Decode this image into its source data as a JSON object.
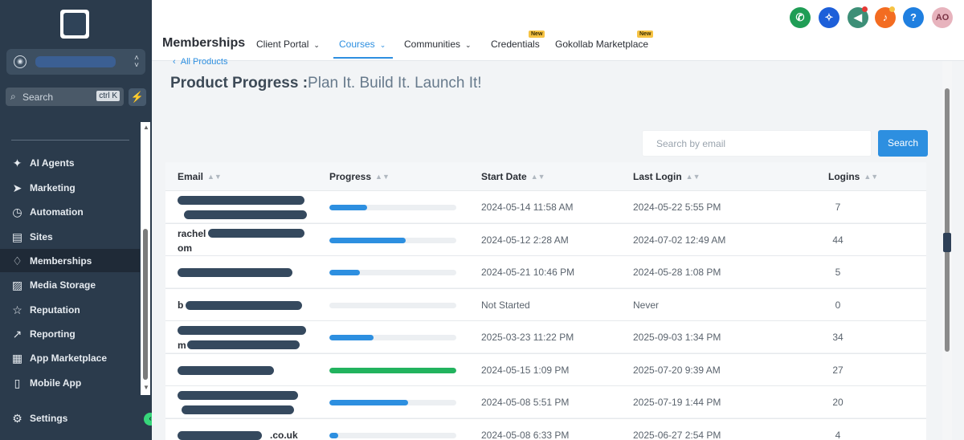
{
  "sidebar": {
    "search_placeholder": "Search",
    "search_shortcut": "ctrl K",
    "nav": [
      {
        "label": "AI Agents",
        "icon": "sparkle-icon",
        "glyph": "✦"
      },
      {
        "label": "Marketing",
        "icon": "send-icon",
        "glyph": "➤"
      },
      {
        "label": "Automation",
        "icon": "play-circle-icon",
        "glyph": "◷"
      },
      {
        "label": "Sites",
        "icon": "browser-icon",
        "glyph": "▤"
      },
      {
        "label": "Memberships",
        "icon": "award-icon",
        "glyph": "♢"
      },
      {
        "label": "Media Storage",
        "icon": "image-icon",
        "glyph": "▨"
      },
      {
        "label": "Reputation",
        "icon": "star-icon",
        "glyph": "☆"
      },
      {
        "label": "Reporting",
        "icon": "trend-icon",
        "glyph": "↗"
      },
      {
        "label": "App Marketplace",
        "icon": "grid-icon",
        "glyph": "▦"
      },
      {
        "label": "Mobile App",
        "icon": "phone-icon",
        "glyph": "▯"
      }
    ],
    "active": "Memberships",
    "settings_label": "Settings"
  },
  "header": {
    "section_title": "Memberships",
    "tabs": [
      {
        "label": "Client Portal",
        "dropdown": true,
        "badge": ""
      },
      {
        "label": "Courses",
        "dropdown": true,
        "badge": ""
      },
      {
        "label": "Communities",
        "dropdown": true,
        "badge": ""
      },
      {
        "label": "Credentials",
        "dropdown": false,
        "badge": "New"
      },
      {
        "label": "Gokollab Marketplace",
        "dropdown": false,
        "badge": "New"
      }
    ],
    "active_tab": "Courses",
    "avatar_initials": "AO",
    "help_glyph": "?"
  },
  "page": {
    "back_link": "All Products",
    "title_prefix": "Product Progress :",
    "title_product": "Plan It. Build It. Launch It!",
    "search_placeholder": "Search by email",
    "search_button": "Search"
  },
  "table": {
    "columns": [
      "Email",
      "Progress",
      "Start Date",
      "Last Login",
      "Logins"
    ],
    "rows": [
      {
        "email_lines": [
          "",
          ""
        ],
        "progress": 0.3,
        "color": "#2d8fe0",
        "start": "2024-05-14 11:58 AM",
        "last": "2024-05-22 5:55 PM",
        "logins": "7"
      },
      {
        "email_lines": [
          "rachel",
          "om"
        ],
        "progress": 0.6,
        "color": "#2d8fe0",
        "start": "2024-05-12 2:28 AM",
        "last": "2024-07-02 12:49 AM",
        "logins": "44"
      },
      {
        "email_lines": [
          "",
          ""
        ],
        "progress": 0.24,
        "color": "#2d8fe0",
        "start": "2024-05-21 10:46 PM",
        "last": "2024-05-28 1:08 PM",
        "logins": "5"
      },
      {
        "email_lines": [
          "b",
          ""
        ],
        "progress": 0,
        "color": "#2d8fe0",
        "start": "Not Started",
        "last": "Never",
        "logins": "0"
      },
      {
        "email_lines": [
          "",
          "m"
        ],
        "progress": 0.35,
        "color": "#2d8fe0",
        "start": "2025-03-23 11:22 PM",
        "last": "2025-09-03 1:34 PM",
        "logins": "34"
      },
      {
        "email_lines": [
          "",
          ""
        ],
        "progress": 1.0,
        "color": "#22b35e",
        "start": "2024-05-15 1:09 PM",
        "last": "2025-07-20 9:39 AM",
        "logins": "27"
      },
      {
        "email_lines": [
          "",
          ""
        ],
        "progress": 0.62,
        "color": "#2d8fe0",
        "start": "2024-05-08 5:51 PM",
        "last": "2025-07-19 1:44 PM",
        "logins": "20"
      },
      {
        "email_lines": [
          ".co.uk",
          ""
        ],
        "progress": 0.07,
        "color": "#2d8fe0",
        "start": "2024-05-08 6:33 PM",
        "last": "2025-06-27 2:54 PM",
        "logins": "4"
      }
    ]
  }
}
